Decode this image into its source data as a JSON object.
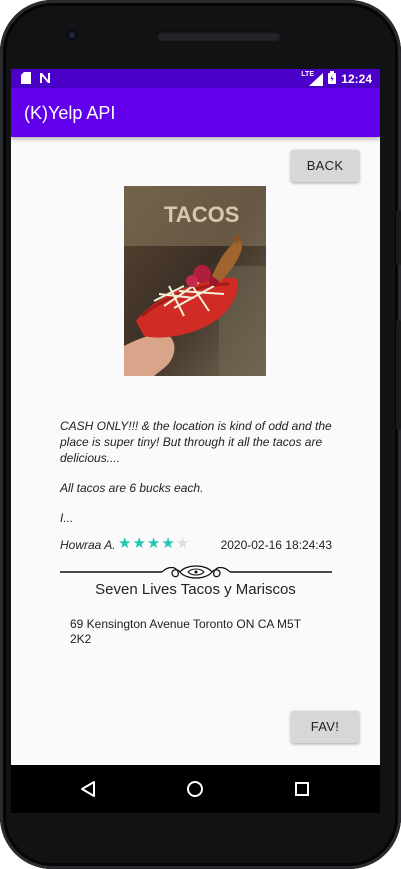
{
  "status_bar": {
    "time": "12:24",
    "lte": "LTE",
    "icons": [
      "sd-card-icon",
      "n-notification-icon",
      "lte-signal-icon",
      "battery-icon"
    ]
  },
  "app_bar": {
    "title": "(K)Yelp API",
    "color": "#6200ee"
  },
  "buttons": {
    "back_label": "BACK",
    "fav_label": "FAV!"
  },
  "photo": {
    "sign_text": "TACOS"
  },
  "review": {
    "paragraphs": [
      "CASH ONLY!!! & the location is kind of odd and the place is super tiny! But through it all the tacos are delicious....",
      "All tacos are 6 bucks each.",
      "I..."
    ],
    "reviewer": "Howraa A.",
    "rating": 4,
    "max_rating": 5,
    "timestamp": "2020-02-16 18:24:43",
    "star_color": "#1dc7b2"
  },
  "business": {
    "name": "Seven Lives Tacos y Mariscos",
    "address": "69 Kensington Avenue   Toronto ON CA M5T 2K2"
  },
  "nav_bar": {
    "icons": [
      "back-triangle-icon",
      "home-circle-icon",
      "recents-square-icon"
    ]
  }
}
